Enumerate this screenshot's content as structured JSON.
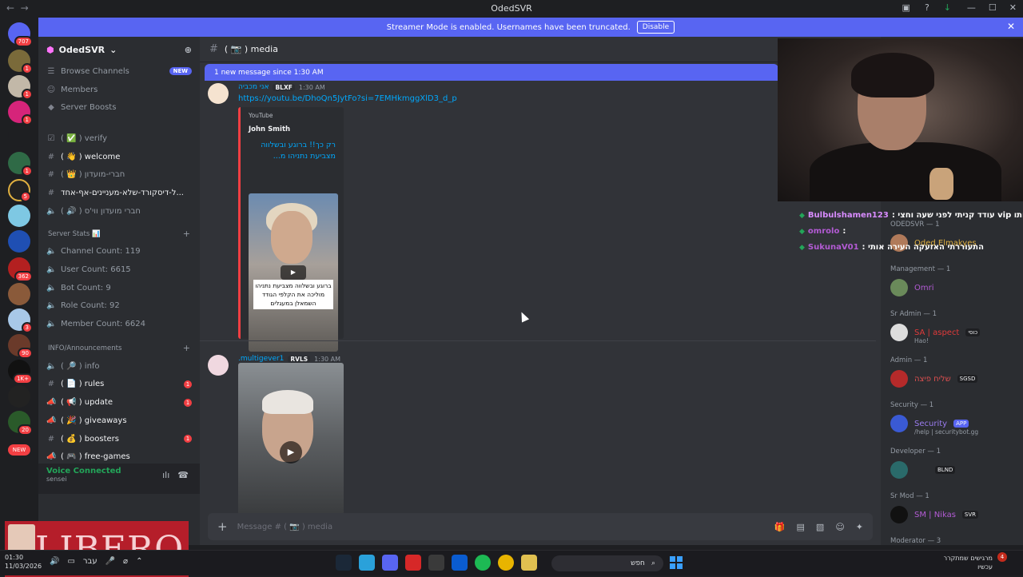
{
  "window": {
    "title": "OdedSVR"
  },
  "banner": {
    "text": "Streamer Mode is enabled. Usernames have been truncated.",
    "button": "Disable"
  },
  "guild_badges": [
    "707",
    "1",
    "1",
    "1",
    "1",
    "5",
    "362",
    "3",
    "90",
    "1K+",
    "20",
    "NEW"
  ],
  "server": {
    "name": "OdedSVR"
  },
  "nav_items": [
    {
      "label": "Browse Channels",
      "badge": "NEW"
    },
    {
      "label": "Members"
    },
    {
      "label": "Server Boosts"
    }
  ],
  "channels_top": [
    {
      "label": "( ✅ ) verify"
    },
    {
      "label": "( 👋 ) welcome"
    },
    {
      "label": "( 👑 ) חברי-מועדון"
    },
    {
      "label": "ל-דיסקורד-שלא-מעניינים-אף-אחד..."
    },
    {
      "label": "( 🔊 ) חברי מועדון ווי'ס"
    }
  ],
  "stats_category": "Server Stats 📊",
  "stats": [
    "Channel Count: 119",
    "User Count: 6615",
    "Bot Count: 9",
    "Role Count: 92",
    "Member Count: 6624"
  ],
  "info_category": "INFO/Announcements",
  "channels_info": [
    {
      "label": "( 🔎 ) info",
      "unread": ""
    },
    {
      "label": "( 📄 ) rules",
      "unread": "1"
    },
    {
      "label": "( 📢 ) update",
      "unread": "1"
    },
    {
      "label": "( 🎉 ) giveaways",
      "unread": ""
    },
    {
      "label": "( 💰 ) boosters",
      "unread": "1"
    },
    {
      "label": "( 🎮 ) free-games",
      "unread": ""
    }
  ],
  "voice": {
    "status": "Voice Connected",
    "channel": "sensei"
  },
  "overlay_brand": "LIBERO",
  "channel_header": {
    "name": "( 📷 )  media"
  },
  "new_messages": "1 new message since 1:30 AM",
  "message1": {
    "username": "אני מכביה",
    "tag": "BLXF",
    "time": "1:30 AM",
    "link": "https://youtu.be/DhoQn5JytFo?si=7EMHkmggXlD3_d_p",
    "embed": {
      "provider": "YouTube",
      "author": "John Smith",
      "title": "רק כך!! ברוגע ובשלווה מצביעת נתניהו מ...",
      "caption": "ברוגע ובשלווה מצביעת נתניהו מוליכה את הקלפי הגודד השמאלן במעגלים"
    }
  },
  "message2": {
    "username": ".multigever1",
    "tag": "RVLS",
    "time": "1:30 AM"
  },
  "composer": {
    "placeholder": "Message # ( 📷 ) media"
  },
  "member_groups": [
    {
      "title": "ODEDSVR — 1",
      "members": [
        {
          "name": "Oded Elmakyes"
        }
      ]
    },
    {
      "title": "Management — 1",
      "members": [
        {
          "name": "Omri"
        }
      ]
    },
    {
      "title": "Sr Admin — 1",
      "members": [
        {
          "name": "SA | aspect",
          "tag": "כוסי",
          "sub": "Hao!"
        }
      ]
    },
    {
      "title": "Admin — 1",
      "members": [
        {
          "name": "שליח פיצה",
          "tag": "SGSD"
        }
      ]
    },
    {
      "title": "Security — 1",
      "members": [
        {
          "name": "Security",
          "tag": "APP",
          "sub": "/help | securitybot.gg"
        }
      ]
    },
    {
      "title": "Developer — 1",
      "members": [
        {
          "name": "",
          "tag": "BLND"
        }
      ]
    },
    {
      "title": "Sr Mod — 1",
      "members": [
        {
          "name": "SM | Nikas",
          "tag": "SVR"
        }
      ]
    },
    {
      "title": "Moderator — 3",
      "members": []
    }
  ],
  "chat_overlay": [
    {
      "user": "Bulbulshamen123",
      "text": "אותו vip עודד קניתי לפני שעה וחצי :"
    },
    {
      "user": "omrolo",
      "text": ":"
    },
    {
      "user": "SukunaV01",
      "text": "התעוררתי האזעקה העירה אותי :"
    }
  ],
  "taskbar": {
    "time": "01:30",
    "date": "11/03/2026",
    "lang": "עבר",
    "search": "חפש",
    "notif_line1": "מרגישים שמתקרר",
    "notif_line2": "עכשיו",
    "notif_badge": "4"
  }
}
